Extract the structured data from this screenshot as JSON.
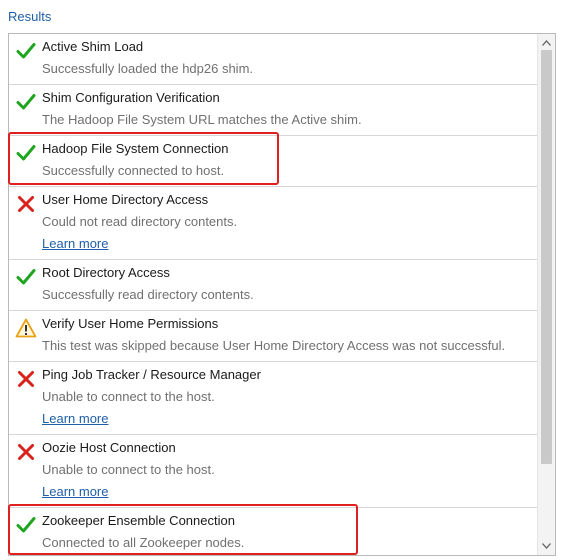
{
  "section": {
    "label": "Results"
  },
  "results": [
    {
      "title": "Active Shim Load",
      "message": "Successfully loaded the hdp26 shim.",
      "status": "success",
      "icon": "check-icon",
      "link": ""
    },
    {
      "title": "Shim Configuration Verification",
      "message": "The Hadoop File System URL matches the Active shim.",
      "status": "success",
      "icon": "check-icon",
      "link": ""
    },
    {
      "title": "Hadoop File System Connection",
      "message": "Successfully connected to host.",
      "status": "success",
      "icon": "check-icon",
      "link": ""
    },
    {
      "title": "User Home Directory Access",
      "message": "Could not read directory contents.",
      "status": "error",
      "icon": "cross-icon",
      "link": "Learn more"
    },
    {
      "title": "Root Directory Access",
      "message": "Successfully read directory contents.",
      "status": "success",
      "icon": "check-icon",
      "link": ""
    },
    {
      "title": "Verify User Home Permissions",
      "message": "This test was skipped because User Home Directory Access was not successful.",
      "status": "warning",
      "icon": "warning-icon",
      "link": ""
    },
    {
      "title": "Ping Job Tracker / Resource Manager",
      "message": "Unable to connect to the host.",
      "status": "error",
      "icon": "cross-icon",
      "link": "Learn more"
    },
    {
      "title": "Oozie Host Connection",
      "message": "Unable to connect to the host.",
      "status": "error",
      "icon": "cross-icon",
      "link": "Learn more"
    },
    {
      "title": "Zookeeper Ensemble Connection",
      "message": "Connected to all Zookeeper nodes.",
      "status": "success",
      "icon": "check-icon",
      "link": ""
    }
  ],
  "colors": {
    "success": "#1fa51f",
    "error": "#d9221c",
    "warning": "#e7a417",
    "link": "#1f5fa8",
    "highlight": "#e02020"
  }
}
